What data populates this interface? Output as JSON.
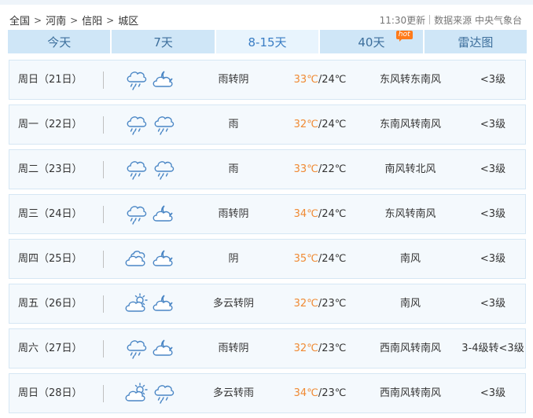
{
  "breadcrumb": [
    "全国",
    "河南",
    "信阳",
    "城区"
  ],
  "breadcrumb_sep": ">",
  "update_time": "11:30更新",
  "source_label": "数据来源 中央气象台",
  "tabs": [
    {
      "label": "今天",
      "active": false
    },
    {
      "label": "7天",
      "active": false
    },
    {
      "label": "8-15天",
      "active": true
    },
    {
      "label": "40天",
      "active": false,
      "badge": "hot"
    },
    {
      "label": "雷达图",
      "active": false
    }
  ],
  "colors": {
    "tab_bg": "#cfe6f7",
    "tab_active_bg": "#e8f4fd",
    "high_temp": "#f08a33",
    "row_bg": "#f4f9fd",
    "hot_badge": "#ff7a1a"
  },
  "forecast": [
    {
      "day": "周日（21日）",
      "icon1": "rain-cloud-icon",
      "icon2": "cloudy-night-icon",
      "cond": "雨转阴",
      "high": "33℃",
      "low": "/24℃",
      "wind": "东风转东南风",
      "level": "<3级"
    },
    {
      "day": "周一（22日）",
      "icon1": "rain-cloud-icon",
      "icon2": "rain-cloud-icon",
      "cond": "雨",
      "high": "32℃",
      "low": "/24℃",
      "wind": "东南风转南风",
      "level": "<3级"
    },
    {
      "day": "周二（23日）",
      "icon1": "rain-cloud-icon",
      "icon2": "rain-cloud-icon",
      "cond": "雨",
      "high": "33℃",
      "low": "/22℃",
      "wind": "南风转北风",
      "level": "<3级"
    },
    {
      "day": "周三（24日）",
      "icon1": "rain-cloud-icon",
      "icon2": "cloudy-night-icon",
      "cond": "雨转阴",
      "high": "34℃",
      "low": "/24℃",
      "wind": "东风转南风",
      "level": "<3级"
    },
    {
      "day": "周四（25日）",
      "icon1": "overcast-cloud-icon",
      "icon2": "cloudy-night-icon",
      "cond": "阴",
      "high": "35℃",
      "low": "/24℃",
      "wind": "南风",
      "level": "<3级"
    },
    {
      "day": "周五（26日）",
      "icon1": "partly-sunny-icon",
      "icon2": "cloudy-night-icon",
      "cond": "多云转阴",
      "high": "32℃",
      "low": "/23℃",
      "wind": "南风",
      "level": "<3级"
    },
    {
      "day": "周六（27日）",
      "icon1": "rain-cloud-icon",
      "icon2": "cloudy-night-icon",
      "cond": "雨转阴",
      "high": "32℃",
      "low": "/23℃",
      "wind": "西南风转南风",
      "level": "3-4级转<3级"
    },
    {
      "day": "周日（28日）",
      "icon1": "partly-sunny-icon",
      "icon2": "rain-cloud-icon",
      "cond": "多云转雨",
      "high": "34℃",
      "low": "/23℃",
      "wind": "西南风转南风",
      "level": "<3级"
    }
  ]
}
